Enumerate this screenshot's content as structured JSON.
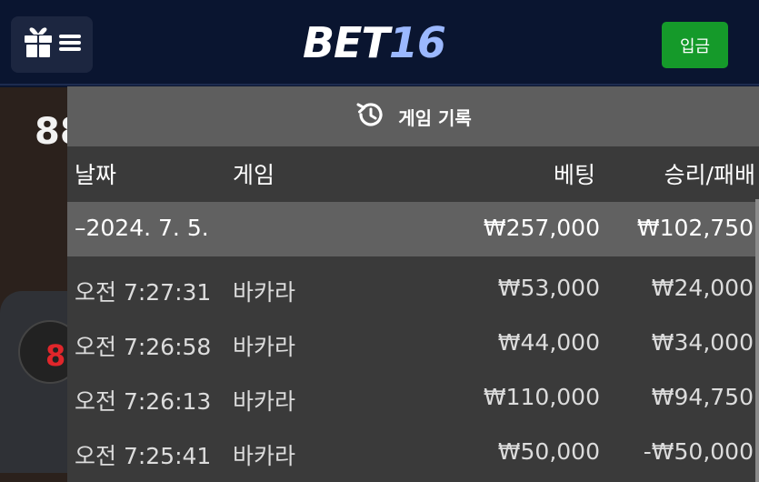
{
  "header": {
    "logo_part1": "BET",
    "logo_part2": "16",
    "deposit_label": "입금"
  },
  "background": {
    "brand_fragment": "88",
    "digit": "8"
  },
  "history": {
    "title": "게임 기록",
    "columns": {
      "date": "날짜",
      "game": "게임",
      "bet": "베팅",
      "winloss": "승리/패배"
    },
    "summary": {
      "date": "–2024. 7. 5.",
      "game": "",
      "bet": "₩257,000",
      "winloss": "₩102,750"
    },
    "rows": [
      {
        "date": "오전 7:27:31",
        "game": "바카라",
        "bet": "₩53,000",
        "winloss": "₩24,000"
      },
      {
        "date": "오전 7:26:58",
        "game": "바카라",
        "bet": "₩44,000",
        "winloss": "₩34,000"
      },
      {
        "date": "오전 7:26:13",
        "game": "바카라",
        "bet": "₩110,000",
        "winloss": "₩94,750"
      },
      {
        "date": "오전 7:25:41",
        "game": "바카라",
        "bet": "₩50,000",
        "winloss": "-₩50,000"
      }
    ]
  },
  "colors": {
    "header_bg": "#0a1530",
    "deposit_green": "#159a2a",
    "logo_accent": "#9bb8ff",
    "sheet_bg": "#3a3a3a",
    "title_bar_bg": "#5e5e5e"
  },
  "icons": {
    "menu": "gift-icon",
    "menu_lines": "hamburger-icon",
    "history": "history-icon"
  }
}
